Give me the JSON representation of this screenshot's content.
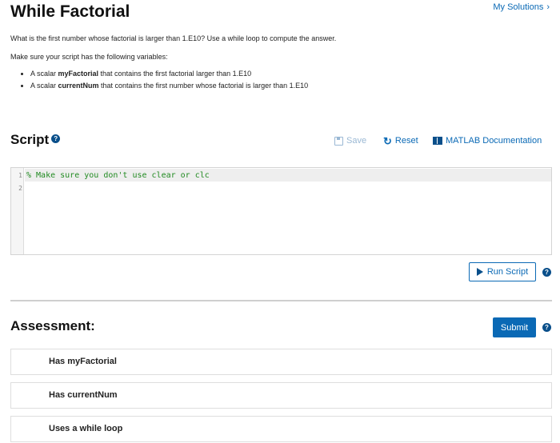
{
  "header": {
    "title": "While Factorial",
    "my_solutions": "My Solutions",
    "my_solutions_icon": "chevron-right-icon"
  },
  "problem": {
    "line1": "What is the first number whose factorial is larger than 1.E10? Use a while loop to compute the answer.",
    "line2": "Make sure your script has the following variables:",
    "bullets": [
      {
        "prefix": "A scalar ",
        "name": "myFactorial",
        "suffix": " that contains the first factorial larger than 1.E10"
      },
      {
        "prefix": "A scalar ",
        "name": "currentNum",
        "suffix": " that contains the first number whose factorial is larger than 1.E10"
      }
    ]
  },
  "script": {
    "heading": "Script",
    "save_label": "Save",
    "reset_label": "Reset",
    "docs_label": "MATLAB Documentation",
    "line_numbers": [
      "1",
      "2"
    ],
    "code_line1": "% Make sure you don't use clear or clc",
    "run_label": "Run Script"
  },
  "assessment": {
    "heading": "Assessment:",
    "submit_label": "Submit",
    "items": [
      "Has myFactorial",
      "Has currentNum",
      "Uses a while loop"
    ]
  },
  "colors": {
    "accent": "#0a69b5",
    "code_comment": "#228b22"
  }
}
